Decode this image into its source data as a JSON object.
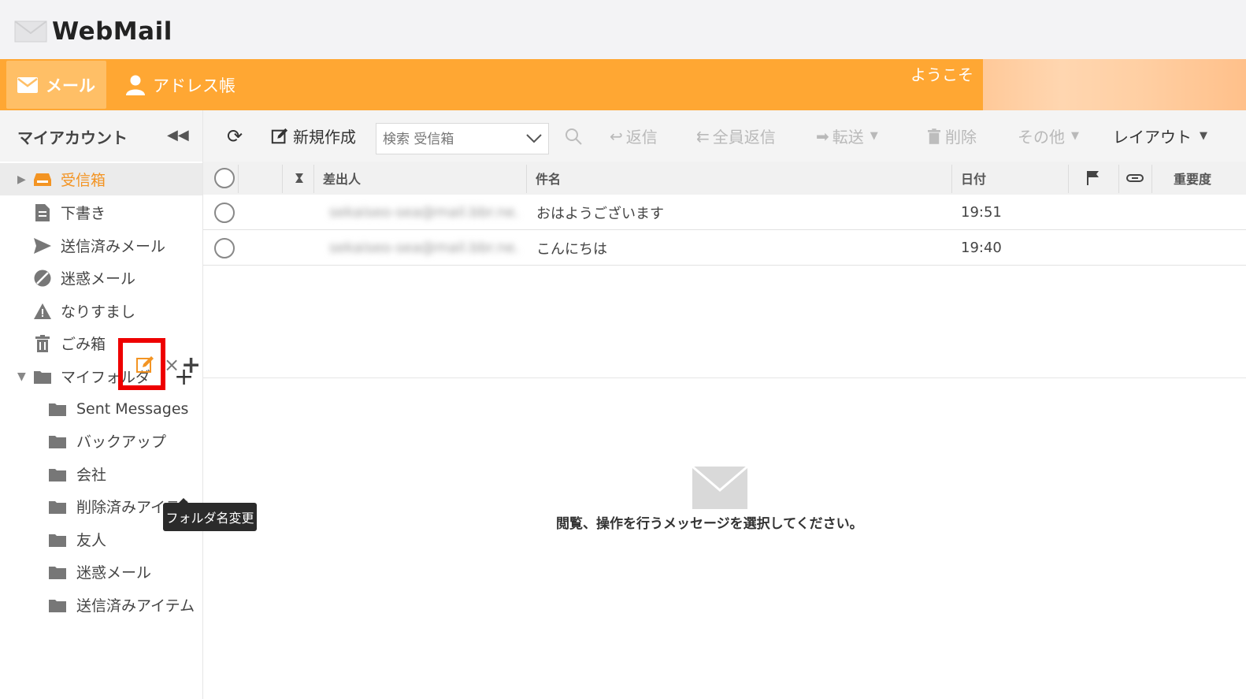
{
  "app": {
    "logo_text": "WebMail"
  },
  "nav": {
    "mail_label": "メール",
    "address_label": "アドレス帳",
    "welcome": "ようこそ"
  },
  "sidebar": {
    "title": "マイアカウント",
    "folders": [
      {
        "label": "受信箱",
        "icon": "inbox-icon"
      },
      {
        "label": "下書き",
        "icon": "draft-icon"
      },
      {
        "label": "送信済みメール",
        "icon": "send-icon"
      },
      {
        "label": "迷惑メール",
        "icon": "spam-icon"
      },
      {
        "label": "なりすまし",
        "icon": "warning-icon"
      },
      {
        "label": "ごみ箱",
        "icon": "trash-icon"
      }
    ],
    "my_folder_label": "マイフォルダ",
    "subfolders": [
      {
        "label": "Sent Messages"
      },
      {
        "label": "バックアップ"
      },
      {
        "label": "会社"
      },
      {
        "label": "削除済みアイテム"
      },
      {
        "label": "友人"
      },
      {
        "label": "迷惑メール"
      },
      {
        "label": "送信済みアイテム"
      }
    ],
    "tooltip": "フォルダ名変更"
  },
  "toolbar": {
    "compose": "新規作成",
    "search_placeholder": "検索 受信箱",
    "reply": "返信",
    "reply_all": "全員返信",
    "forward": "転送",
    "delete": "削除",
    "more": "その他",
    "layout": "レイアウト"
  },
  "list": {
    "headers": {
      "from": "差出人",
      "subject": "件名",
      "date": "日付",
      "priority": "重要度"
    },
    "rows": [
      {
        "from": "sekaiseo-sea@mail.bbr.ne.jp",
        "subject": "おはようございます",
        "date": "19:51"
      },
      {
        "from": "sekaiseo-sea@mail.bbr.ne.jp",
        "subject": "こんにちは",
        "date": "19:40"
      }
    ]
  },
  "preview": {
    "empty_text": "閲覧、操作を行うメッセージを選択してください。"
  },
  "colors": {
    "accent": "#ffa733",
    "highlight": "#f39423",
    "annotation": "#ee0000"
  }
}
